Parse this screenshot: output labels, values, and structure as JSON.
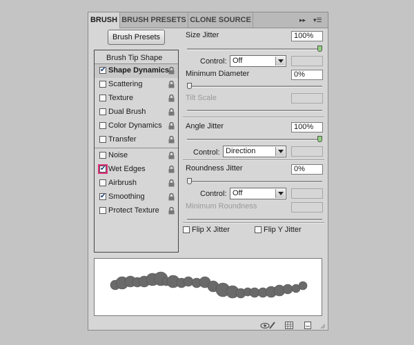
{
  "tabs": [
    {
      "label": "BRUSH",
      "active": true
    },
    {
      "label": "BRUSH PRESETS",
      "active": false
    },
    {
      "label": "CLONE SOURCE",
      "active": false
    }
  ],
  "tab_controls": {
    "expand": "▸▸",
    "menu": "▾☰"
  },
  "brush_presets_button": "Brush Presets",
  "brush_tip_shape": "Brush Tip Shape",
  "options": [
    {
      "label": "Shape Dynamics",
      "checked": true
    },
    {
      "label": "Scattering",
      "checked": false
    },
    {
      "label": "Texture",
      "checked": false
    },
    {
      "label": "Dual Brush",
      "checked": false
    },
    {
      "label": "Color Dynamics",
      "checked": false
    },
    {
      "label": "Transfer",
      "checked": false
    },
    {
      "label": "Noise",
      "checked": false
    },
    {
      "label": "Wet Edges",
      "checked": true
    },
    {
      "label": "Airbrush",
      "checked": false
    },
    {
      "label": "Smoothing",
      "checked": true
    },
    {
      "label": "Protect Texture",
      "checked": false
    }
  ],
  "check_glyph": "✔",
  "settings": {
    "size_jitter": {
      "label": "Size Jitter",
      "value": "100%",
      "level": 1.0
    },
    "control1": {
      "label": "Control:",
      "value": "Off"
    },
    "minimum_diameter": {
      "label": "Minimum Diameter",
      "value": "0%",
      "level": 0.0
    },
    "tilt_scale": {
      "label": "Tilt Scale"
    },
    "angle_jitter": {
      "label": "Angle Jitter",
      "value": "100%",
      "level": 1.0
    },
    "control2": {
      "label": "Control:",
      "value": "Direction"
    },
    "roundness_jitter": {
      "label": "Roundness Jitter",
      "value": "0%",
      "level": 0.0
    },
    "control3": {
      "label": "Control:",
      "value": "Off"
    },
    "minimum_roundness": {
      "label": "Minimum Roundness"
    },
    "flip_x": {
      "label": "Flip X Jitter",
      "checked": false
    },
    "flip_y": {
      "label": "Flip Y Jitter",
      "checked": false
    }
  },
  "colors": {
    "highlight_ring": "#e0307a",
    "stroke": "#6a6a6a",
    "active_thumb": "#8fd27e"
  },
  "icons": {
    "footer": [
      "eye-brush-icon",
      "panel-grid-icon",
      "new-preset-icon"
    ],
    "lock": "lock-icon"
  }
}
